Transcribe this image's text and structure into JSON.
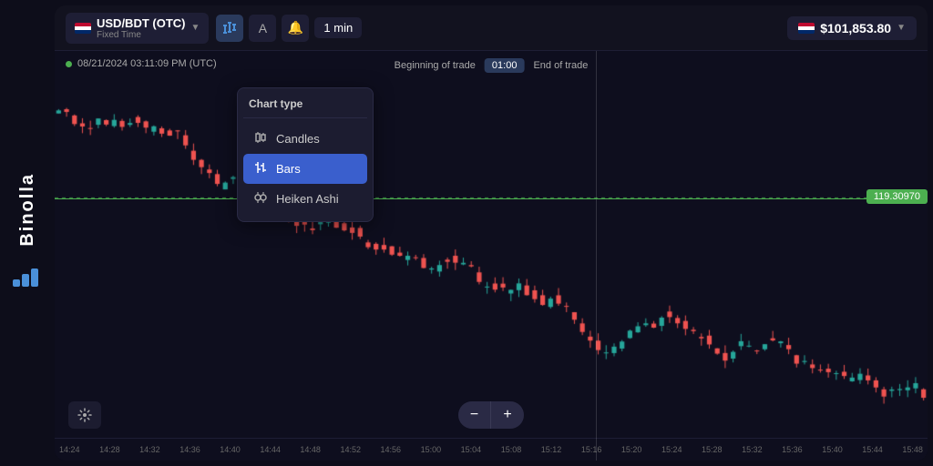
{
  "sidebar": {
    "logo_text": "Binolla",
    "logo_icon": "≡"
  },
  "header": {
    "pair": "USD/BDT (OTC)",
    "subtext": "Fixed Time",
    "timeframe": "1 min",
    "balance": "$101,853.80"
  },
  "toolbar": {
    "chart_type_icon": "↑↓",
    "text_icon": "A",
    "alert_icon": "🔔"
  },
  "chart": {
    "datetime": "08/21/2024 03:11:09 PM (UTC)",
    "trade_start_label": "Beginning of trade",
    "trade_timer": "01:00",
    "trade_end_label": "End of trade",
    "price": "119.30970"
  },
  "chart_type_dropdown": {
    "title": "Chart type",
    "items": [
      {
        "id": "candles",
        "label": "Candles",
        "icon": "∥∥",
        "selected": false
      },
      {
        "id": "bars",
        "label": "Bars",
        "icon": "↑↓",
        "selected": true
      },
      {
        "id": "heiken_ashi",
        "label": "Heiken Ashi",
        "icon": "◈",
        "selected": false
      }
    ]
  },
  "x_axis": {
    "labels": [
      "14:24",
      "14:28",
      "14:32",
      "14:36",
      "14:40",
      "14:44",
      "14:48",
      "14:52",
      "14:56",
      "15:00",
      "15:04",
      "15:08",
      "15:12",
      "15:16",
      "15:20",
      "15:24",
      "15:28",
      "15:32",
      "15:36",
      "15:40",
      "15:44",
      "15:48"
    ]
  },
  "zoom": {
    "minus": "−",
    "plus": "+"
  }
}
